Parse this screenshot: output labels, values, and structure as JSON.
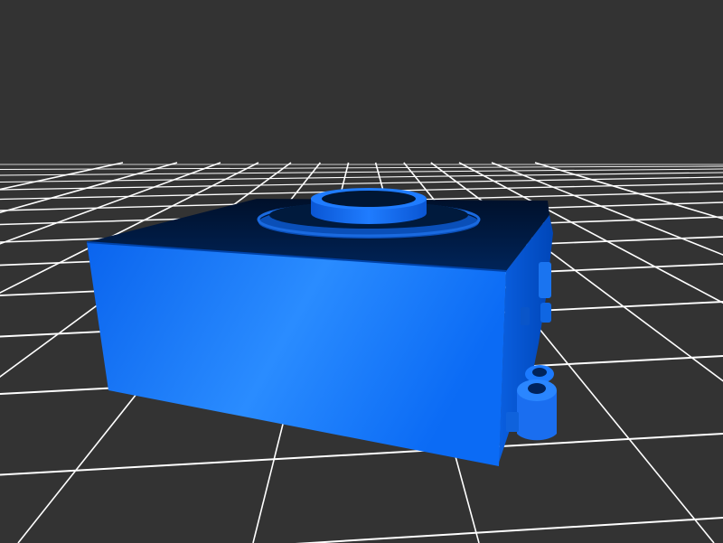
{
  "viewport": {
    "background_color": "#333333"
  },
  "grid": {
    "line_color": "#ffffff",
    "visible": true
  },
  "model": {
    "part_color": "#0a6fff",
    "highlight_color": "#2f8bff",
    "shadow_color": "#003a9e",
    "dark_top_color": "#001a3d",
    "features": [
      "box-body",
      "top-ring-boss",
      "side-fittings"
    ]
  }
}
